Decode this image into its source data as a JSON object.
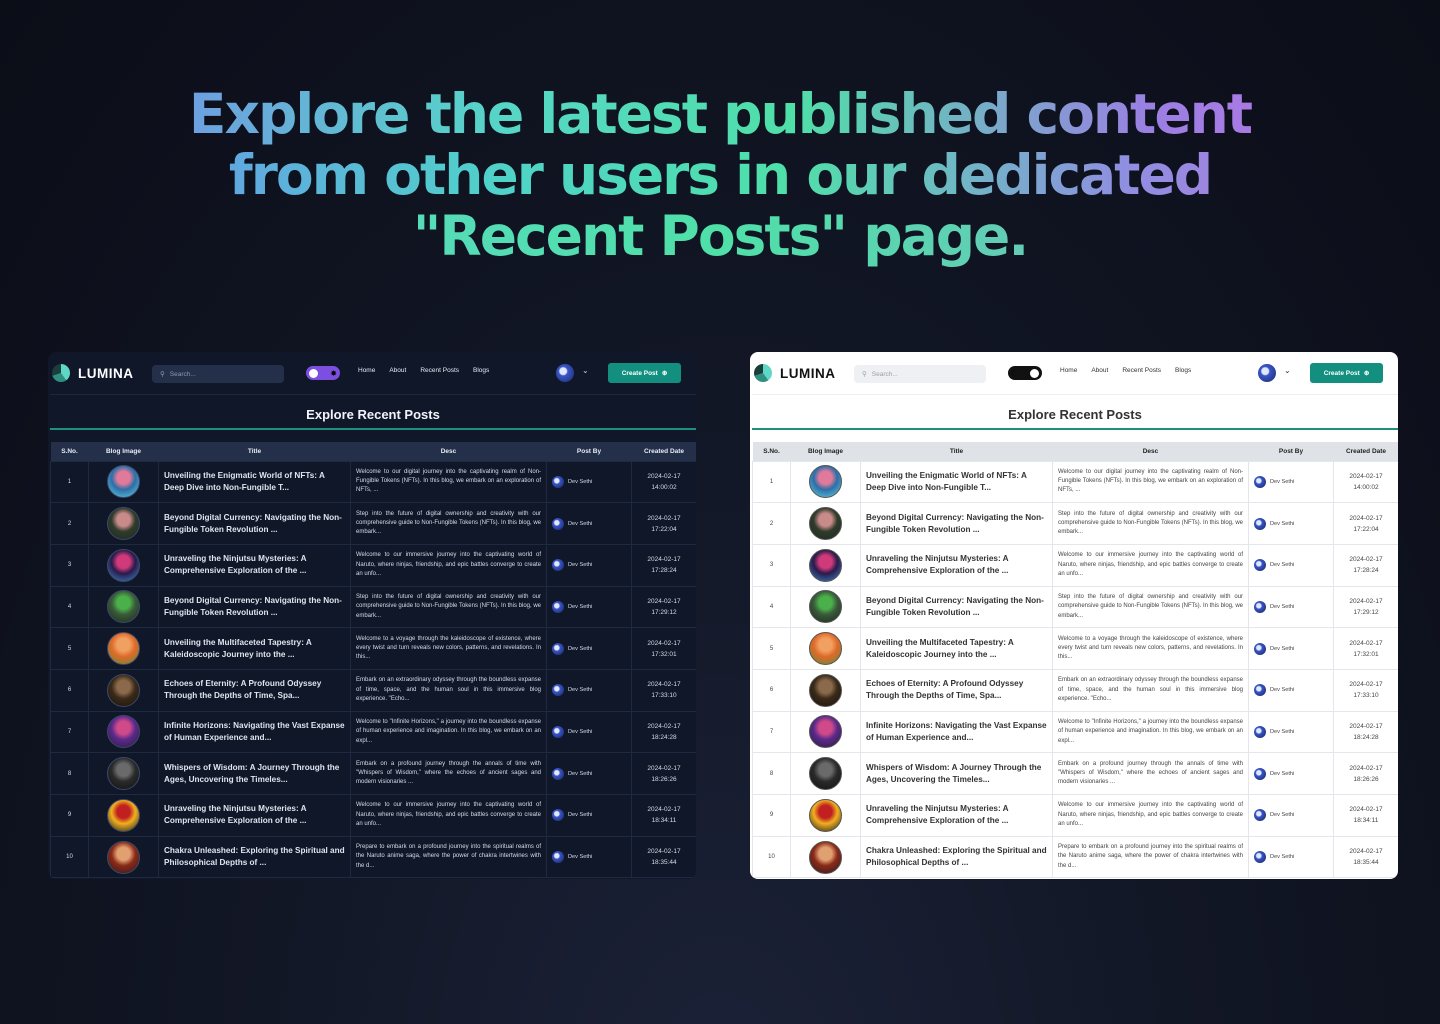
{
  "hero": {
    "line1": "Explore the latest published content",
    "line2": "from other users in our dedicated",
    "line3": "\"Recent Posts\" page."
  },
  "app": {
    "brand": "LUMINA",
    "search_placeholder": "Search...",
    "nav": [
      "Home",
      "About",
      "Recent Posts",
      "Blogs"
    ],
    "create_label": "Create Post",
    "page_title": "Explore Recent Posts",
    "columns": [
      "S.No.",
      "Blog Image",
      "Title",
      "Desc",
      "Post By",
      "Created Date"
    ],
    "accent": "#138f7f",
    "rows": [
      {
        "sno": "1",
        "title": "Unveiling the Enigmatic World of NFTs: A Deep Dive into Non-Fungible T...",
        "desc": "Welcome to our digital journey into the captivating realm of Non-Fungible Tokens (NFTs). In this blog, we embark on an exploration of NFTs, ...",
        "by": "Dev Sethi",
        "date": "2024-02-17",
        "time": "14:00:02",
        "thumb": [
          "#2b6fa8",
          "#e07a9a",
          "#6ad0e0"
        ]
      },
      {
        "sno": "2",
        "title": "Beyond Digital Currency: Navigating the Non-Fungible Token Revolution ...",
        "desc": "Step into the future of digital ownership and creativity with our comprehensive guide to Non-Fungible Tokens (NFTs). In this blog, we embark...",
        "by": "Dev Sethi",
        "date": "2024-02-17",
        "time": "17:22:04",
        "thumb": [
          "#2f3b2a",
          "#c98a8a",
          "#1e2a22"
        ]
      },
      {
        "sno": "3",
        "title": "Unraveling the Ninjutsu Mysteries: A Comprehensive Exploration of the ...",
        "desc": "Welcome to our immersive journey into the captivating world of Naruto, where ninjas, friendship, and epic battles converge to create an unfo...",
        "by": "Dev Sethi",
        "date": "2024-02-17",
        "time": "17:28:24",
        "thumb": [
          "#2a1a4a",
          "#d03a7a",
          "#3a8ad0"
        ]
      },
      {
        "sno": "4",
        "title": "Beyond Digital Currency: Navigating the Non-Fungible Token Revolution ...",
        "desc": "Step into the future of digital ownership and creativity with our comprehensive guide to Non-Fungible Tokens (NFTs). In this blog, we embark...",
        "by": "Dev Sethi",
        "date": "2024-02-17",
        "time": "17:29:12",
        "thumb": [
          "#3a5a3a",
          "#4ab04a",
          "#1a2a1a"
        ]
      },
      {
        "sno": "5",
        "title": "Unveiling the Multifaceted Tapestry: A Kaleidoscopic Journey into the ...",
        "desc": "Welcome to a voyage through the kaleidoscope of existence, where every twist and turn reveals new colors, patterns, and revelations. In this...",
        "by": "Dev Sethi",
        "date": "2024-02-17",
        "time": "17:32:01",
        "thumb": [
          "#e06a2a",
          "#f0a060",
          "#5a8a3a"
        ]
      },
      {
        "sno": "6",
        "title": "Echoes of Eternity: A Profound Odyssey Through the Depths of Time, Spa...",
        "desc": "Embark on an extraordinary odyssey through the boundless expanse of time, space, and the human soul in this immersive blog experience. \"Echo...",
        "by": "Dev Sethi",
        "date": "2024-02-17",
        "time": "17:33:10",
        "thumb": [
          "#3a2a1a",
          "#8a6a4a",
          "#1a1208"
        ]
      },
      {
        "sno": "7",
        "title": "Infinite Horizons: Navigating the Vast Expanse of Human Experience and...",
        "desc": "Welcome to \"Infinite Horizons,\" a journey into the boundless expanse of human experience and imagination. In this blog, we embark on an expl...",
        "by": "Dev Sethi",
        "date": "2024-02-17",
        "time": "18:24:28",
        "thumb": [
          "#5a2a8a",
          "#d04a8a",
          "#2a1a3a"
        ]
      },
      {
        "sno": "8",
        "title": "Whispers of Wisdom: A Journey Through the Ages, Uncovering the Timeles...",
        "desc": "Embark on a profound journey through the annals of time with \"Whispers of Wisdom,\" where the echoes of ancient sages and modern visionaries ...",
        "by": "Dev Sethi",
        "date": "2024-02-17",
        "time": "18:26:26",
        "thumb": [
          "#2a2a2a",
          "#6a6a6a",
          "#101010"
        ]
      },
      {
        "sno": "9",
        "title": "Unraveling the Ninjutsu Mysteries: A Comprehensive Exploration of the ...",
        "desc": "Welcome to our immersive journey into the captivating world of Naruto, where ninjas, friendship, and epic battles converge to create an unfo...",
        "by": "Dev Sethi",
        "date": "2024-02-17",
        "time": "18:34:11",
        "thumb": [
          "#f0b020",
          "#c02020",
          "#1a1a1a"
        ]
      },
      {
        "sno": "10",
        "title": "Chakra Unleashed: Exploring the Spiritual and Philosophical Depths of ...",
        "desc": "Prepare to embark on a profound journey into the spiritual realms of the Naruto anime saga, where the power of chakra intertwines with the d...",
        "by": "Dev Sethi",
        "date": "2024-02-17",
        "time": "18:35:44",
        "thumb": [
          "#8a2a1a",
          "#e0a070",
          "#2a1a1a"
        ]
      }
    ]
  }
}
